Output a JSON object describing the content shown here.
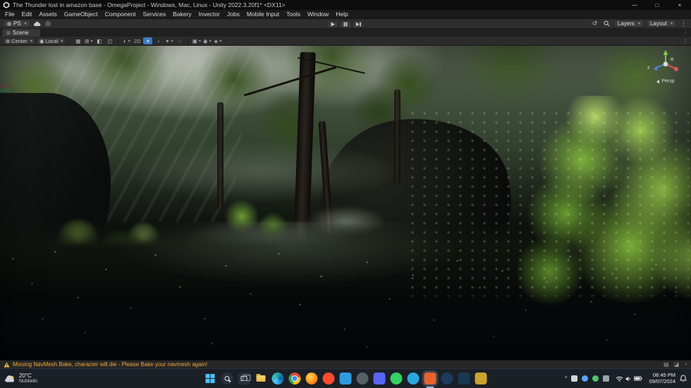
{
  "window": {
    "title": "The Thunder lost in amazon base - OmegaProject - Windows, Mac, Linux - Unity 2022.3.20f1* <DX11>",
    "minimize": "—",
    "maximize": "□",
    "close": "×"
  },
  "menu": {
    "items": [
      "File",
      "Edit",
      "Assets",
      "GameObject",
      "Component",
      "Services",
      "Bakery",
      "Invector",
      "Jobs",
      "Mobile Input",
      "Tools",
      "Window",
      "Help"
    ]
  },
  "toolbar": {
    "version_control": "PS",
    "services_glyph": "◎",
    "history_glyph": "↺",
    "kebab_glyph": "⋮",
    "layers": "Layers",
    "layout": "Layout"
  },
  "scene_tab": {
    "icon_glyph": "⊞",
    "label": "Scene",
    "kebab_glyph": "⋮"
  },
  "scene_toolbar": {
    "pivot_glyph": "⊕",
    "tool_handle": "Center",
    "orientation_glyph": "◉",
    "orientation": "Local",
    "kebab_glyph": "⋮",
    "icons": [
      {
        "name": "grid-visibility-toggle",
        "glyph": "▦"
      },
      {
        "name": "snap-settings",
        "glyph": "⊞"
      },
      {
        "name": "snap-move-toggle",
        "glyph": "◧"
      },
      {
        "name": "snap-rotate-toggle",
        "glyph": "◫"
      },
      {
        "name": "draw-mode-dropdown",
        "glyph": "◐"
      },
      {
        "name": "2d-view-toggle",
        "glyph": "2D"
      },
      {
        "name": "scene-lighting-toggle",
        "glyph": "☀",
        "active": true
      },
      {
        "name": "scene-audio-toggle",
        "glyph": "♪"
      },
      {
        "name": "effects-dropdown",
        "glyph": "✦"
      },
      {
        "name": "hidden-objects-toggle",
        "glyph": "◌"
      },
      {
        "name": "overlays-dropdown",
        "glyph": "▣"
      },
      {
        "name": "camera-settings-dropdown",
        "glyph": "◉"
      },
      {
        "name": "gizmos-dropdown",
        "glyph": "◈"
      }
    ]
  },
  "viewport": {
    "gizmo": {
      "z": "z",
      "projection": "Persp"
    }
  },
  "status_bar": {
    "warning": "Missing NavMesh Bake, character will die - Please Bake your navmesh again!",
    "icons": [
      {
        "name": "status-console-icon",
        "glyph": "▤"
      },
      {
        "name": "status-cache-icon",
        "glyph": "◪"
      },
      {
        "name": "status-progress-icon",
        "glyph": "◔"
      }
    ]
  },
  "taskbar": {
    "weather": {
      "temperature": "20°C",
      "condition": "Nublado"
    },
    "apps": [
      {
        "name": "start",
        "color": "#4cc2ff"
      },
      {
        "name": "search",
        "color": "#2a2f38"
      },
      {
        "name": "task-view",
        "color": "#2a2f38"
      },
      {
        "name": "file-explorer",
        "color": "#f2c14b"
      },
      {
        "name": "edge",
        "color": "#2fb3c7"
      },
      {
        "name": "chrome",
        "color": "#ea4335"
      },
      {
        "name": "firefox",
        "color": "#ff8a1e"
      },
      {
        "name": "opera",
        "color": "#ff4b2d"
      },
      {
        "name": "vscode",
        "color": "#2f9ae0"
      },
      {
        "name": "obs-studio",
        "color": "#576067"
      },
      {
        "name": "discord",
        "color": "#5865f2"
      },
      {
        "name": "whatsapp",
        "color": "#36d066"
      },
      {
        "name": "telegram",
        "color": "#2aa7e0"
      },
      {
        "name": "unity-editor",
        "color": "#e8622e",
        "active": true
      },
      {
        "name": "steam",
        "color": "#1e3a5f"
      },
      {
        "name": "photoshop",
        "color": "#18394f"
      },
      {
        "name": "epic-games",
        "color": "#c9a232"
      }
    ],
    "tray": {
      "chevron_glyph": "^",
      "clock": {
        "time": "08:45 PM",
        "date": "09/07/2024"
      }
    }
  },
  "colors": {
    "accent_blue": "#3a79bf",
    "warning_orange": "#eda73c",
    "taskbar_bg": "#1b1f26"
  }
}
